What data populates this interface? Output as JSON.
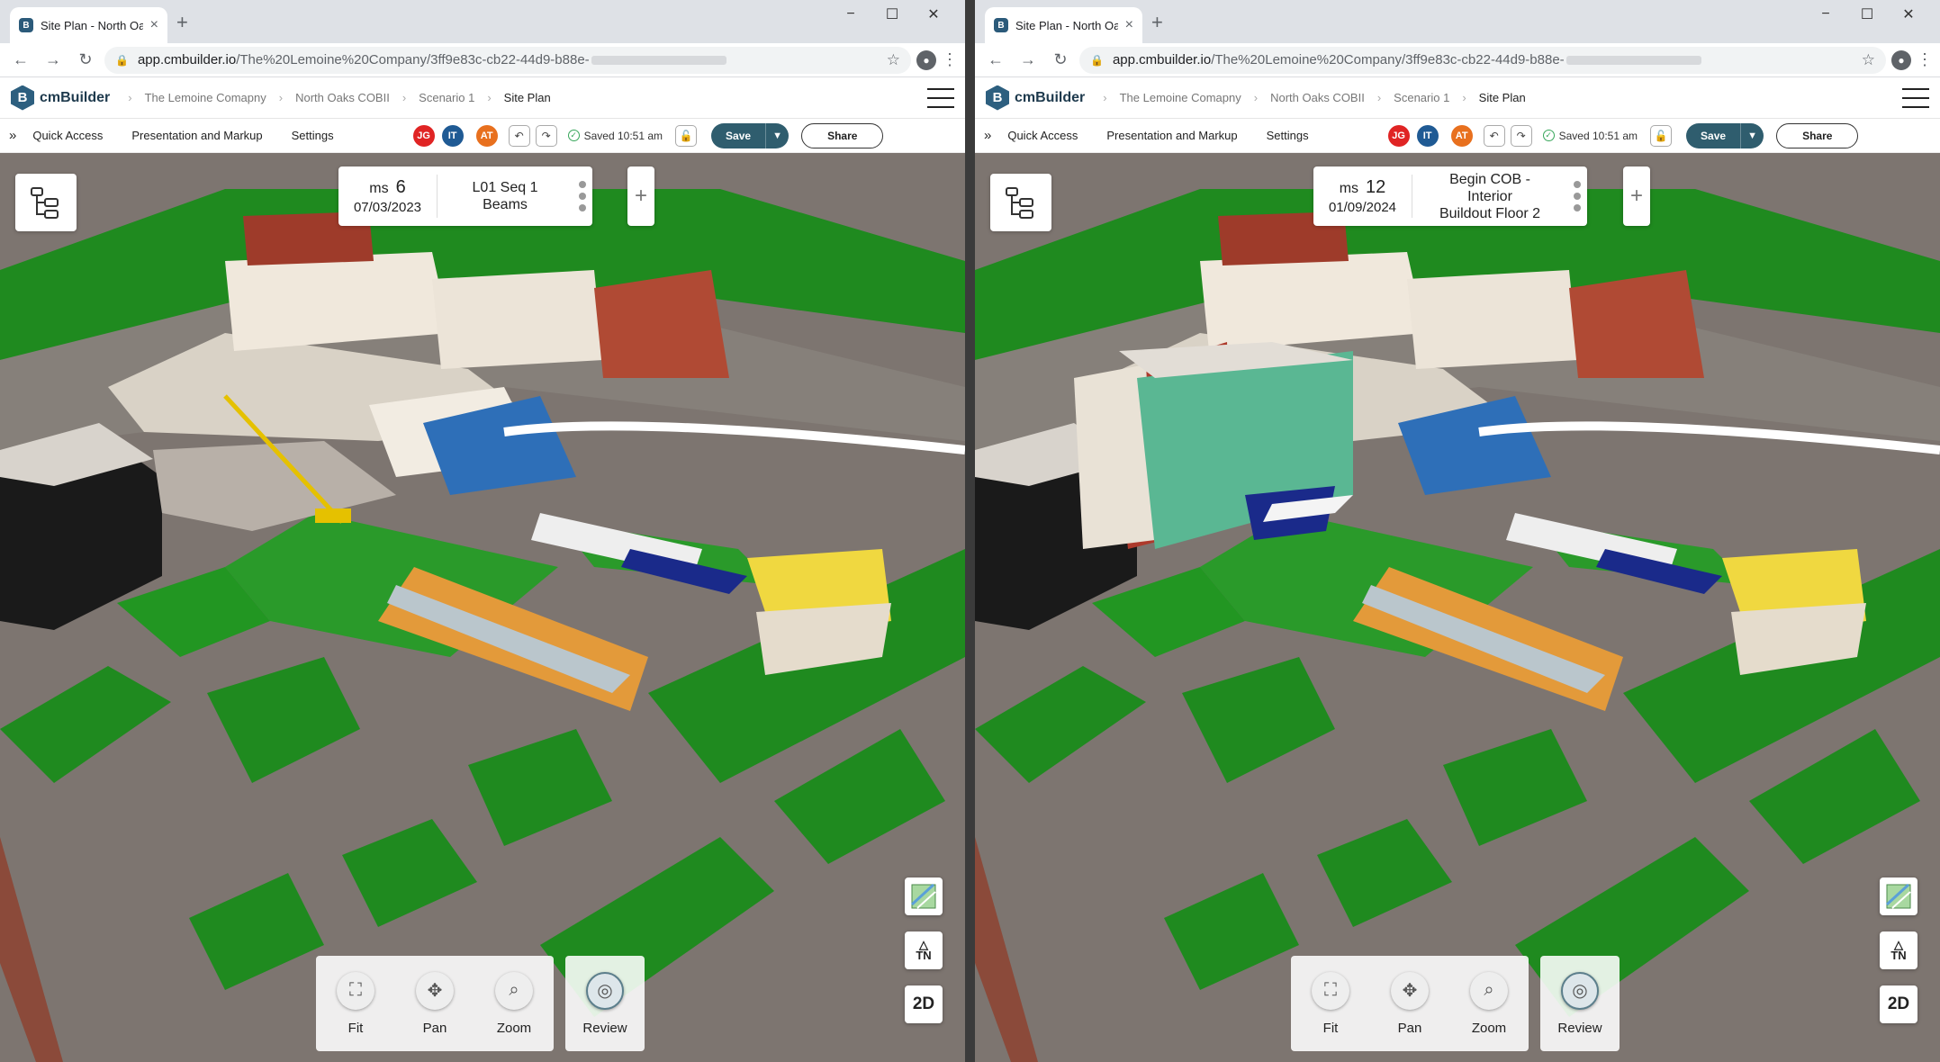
{
  "windows": [
    {
      "tab": {
        "title": "Site Plan - North Oaks COBII",
        "close": "×"
      },
      "new_tab": "+",
      "controls": {
        "minimize": "−",
        "maximize": "☐",
        "close": "✕"
      },
      "address": {
        "host": "app.cmbuilder.io",
        "path": "/The%20Lemoine%20Company/3ff9e83c-cb22-44d9-b88e-"
      },
      "app": {
        "brand": "cmBuilder",
        "breadcrumbs": [
          "The Lemoine Comapny",
          "North Oaks COBII",
          "Scenario 1",
          "Site Plan"
        ],
        "toolbar": {
          "expand": "»",
          "menus": [
            "Quick Access",
            "Presentation and Markup",
            "Settings"
          ],
          "avatars": [
            {
              "initials": "JG",
              "color": "#e02424"
            },
            {
              "initials": "IT",
              "color": "#1f5a94"
            },
            {
              "initials": "AT",
              "color": "#e8701e"
            }
          ],
          "undo": "↶",
          "redo": "↷",
          "saved": "Saved 10:51 am",
          "save": "Save",
          "share": "Share"
        }
      },
      "milestone": {
        "prefix": "ms",
        "number": "6",
        "date": "07/03/2023",
        "name_line1": "L01 Seq 1 Beams",
        "name_line2": ""
      },
      "add_milestone": "+",
      "nav": {
        "fit": "Fit",
        "pan": "Pan",
        "zoom": "Zoom",
        "review": "Review"
      },
      "side": {
        "tn": "TN",
        "view2d": "2D"
      },
      "show_new_building": false
    },
    {
      "tab": {
        "title": "Site Plan - North Oaks COBII",
        "close": "×"
      },
      "new_tab": "+",
      "controls": {
        "minimize": "−",
        "maximize": "☐",
        "close": "✕"
      },
      "address": {
        "host": "app.cmbuilder.io",
        "path": "/The%20Lemoine%20Company/3ff9e83c-cb22-44d9-b88e-"
      },
      "app": {
        "brand": "cmBuilder",
        "breadcrumbs": [
          "The Lemoine Comapny",
          "North Oaks COBII",
          "Scenario 1",
          "Site Plan"
        ],
        "toolbar": {
          "expand": "»",
          "menus": [
            "Quick Access",
            "Presentation and Markup",
            "Settings"
          ],
          "avatars": [
            {
              "initials": "JG",
              "color": "#e02424"
            },
            {
              "initials": "IT",
              "color": "#1f5a94"
            },
            {
              "initials": "AT",
              "color": "#e8701e"
            }
          ],
          "undo": "↶",
          "redo": "↷",
          "saved": "Saved 10:51 am",
          "save": "Save",
          "share": "Share"
        }
      },
      "milestone": {
        "prefix": "ms",
        "number": "12",
        "date": "01/09/2024",
        "name_line1": "Begin COB - Interior",
        "name_line2": "Buildout Floor 2"
      },
      "add_milestone": "+",
      "nav": {
        "fit": "Fit",
        "pan": "Pan",
        "zoom": "Zoom",
        "review": "Review"
      },
      "side": {
        "tn": "TN",
        "view2d": "2D"
      },
      "show_new_building": true
    }
  ]
}
